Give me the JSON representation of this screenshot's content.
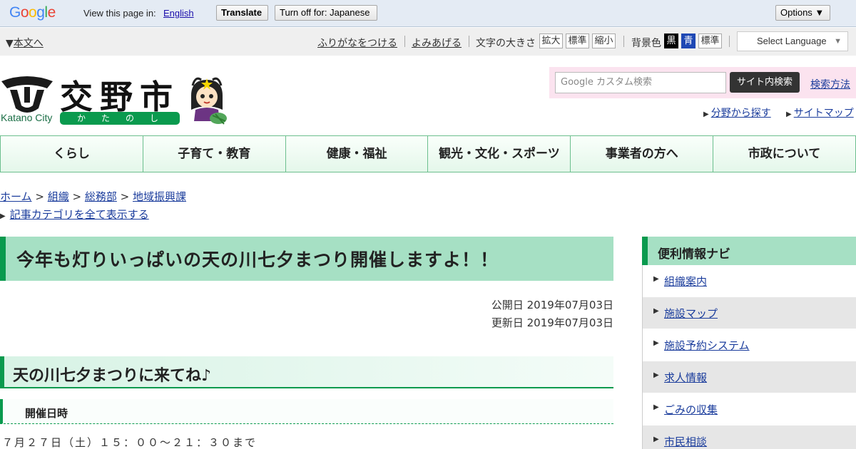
{
  "translate_bar": {
    "logo_letters": [
      "G",
      "o",
      "o",
      "g",
      "l",
      "e"
    ],
    "prompt": "View this page in:",
    "language": "English",
    "translate_label": "Translate",
    "turn_off_label": "Turn off for: Japanese",
    "options_label": "Options ▼"
  },
  "utility": {
    "skip_label": "本文へ",
    "furigana": "ふりがなをつける",
    "read_aloud": "よみあげる",
    "text_size_label": "文字の大きさ",
    "size_enlarge": "拡大",
    "size_standard": "標準",
    "size_reduce": "縮小",
    "bg_color_label": "背景色",
    "bg_black": "黒",
    "bg_blue": "青",
    "bg_standard": "標準",
    "select_language": "Select Language"
  },
  "header": {
    "city_name": "交野市",
    "city_en": "Katano City",
    "city_kana": "かたのし",
    "search_placeholder": "Google カスタム検索",
    "search_button": "サイト内検索",
    "search_help": "検索方法",
    "browse_by_field": "分野から探す",
    "site_map": "サイトマップ"
  },
  "gnav": {
    "items": [
      "くらし",
      "子育て・教育",
      "健康・福祉",
      "観光・文化・スポーツ",
      "事業者の方へ",
      "市政について"
    ]
  },
  "breadcrumb": {
    "home": "ホーム",
    "org": "組織",
    "dept": "総務部",
    "section": "地域振興課",
    "show_all_categories": "記事カテゴリを全て表示する"
  },
  "article": {
    "title": "今年も灯りいっぱいの天の川七夕まつり開催しますよ！！",
    "published": "公開日 2019年07月03日",
    "updated": "更新日 2019年07月03日",
    "h2": "天の川七夕まつりに来てね♪",
    "h3": "開催日時",
    "body": "７月２７日（土）１５：００～２１：３０まで"
  },
  "sidebar": {
    "title": "便利情報ナビ",
    "items": [
      "組織案内",
      "施設マップ",
      "施設予約システム",
      "求人情報",
      "ごみの収集",
      "市民相談"
    ]
  },
  "colors": {
    "brand_green": "#0a9a4e",
    "title_bg": "#a6e0c4",
    "link": "#1a3c9c"
  }
}
